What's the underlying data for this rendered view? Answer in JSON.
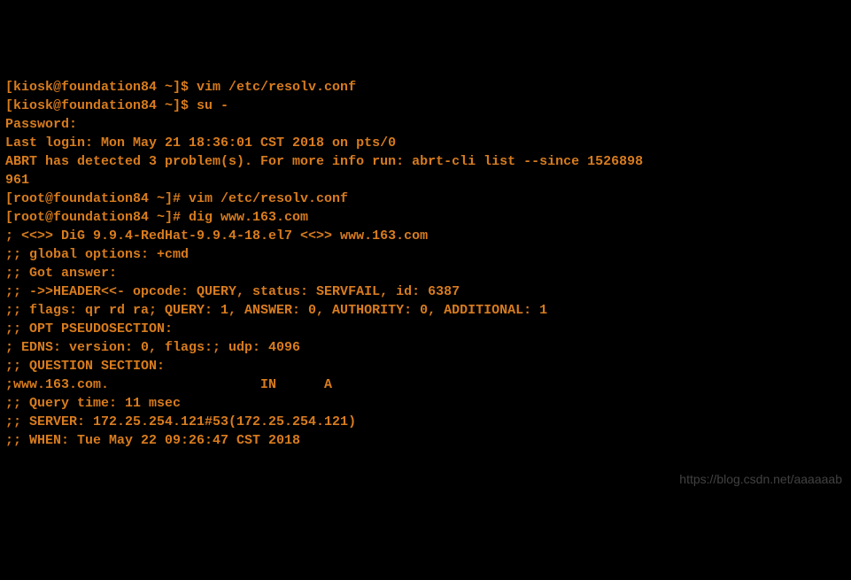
{
  "terminal": {
    "lines": [
      "[kiosk@foundation84 ~]$ vim /etc/resolv.conf",
      "[kiosk@foundation84 ~]$ su -",
      "Password:",
      "Last login: Mon May 21 18:36:01 CST 2018 on pts/0",
      "ABRT has detected 3 problem(s). For more info run: abrt-cli list --since 1526898",
      "961",
      "[root@foundation84 ~]# vim /etc/resolv.conf",
      "[root@foundation84 ~]# dig www.163.com",
      "",
      "; <<>> DiG 9.9.4-RedHat-9.9.4-18.el7 <<>> www.163.com",
      ";; global options: +cmd",
      ";; Got answer:",
      ";; ->>HEADER<<- opcode: QUERY, status: SERVFAIL, id: 6387",
      ";; flags: qr rd ra; QUERY: 1, ANSWER: 0, AUTHORITY: 0, ADDITIONAL: 1",
      "",
      ";; OPT PSEUDOSECTION:",
      "; EDNS: version: 0, flags:; udp: 4096",
      ";; QUESTION SECTION:",
      ";www.163.com.                   IN      A",
      "",
      ";; Query time: 11 msec",
      ";; SERVER: 172.25.254.121#53(172.25.254.121)",
      ";; WHEN: Tue May 22 09:26:47 CST 2018"
    ]
  },
  "watermark": {
    "text": "https://blog.csdn.net/aaaaaab"
  }
}
